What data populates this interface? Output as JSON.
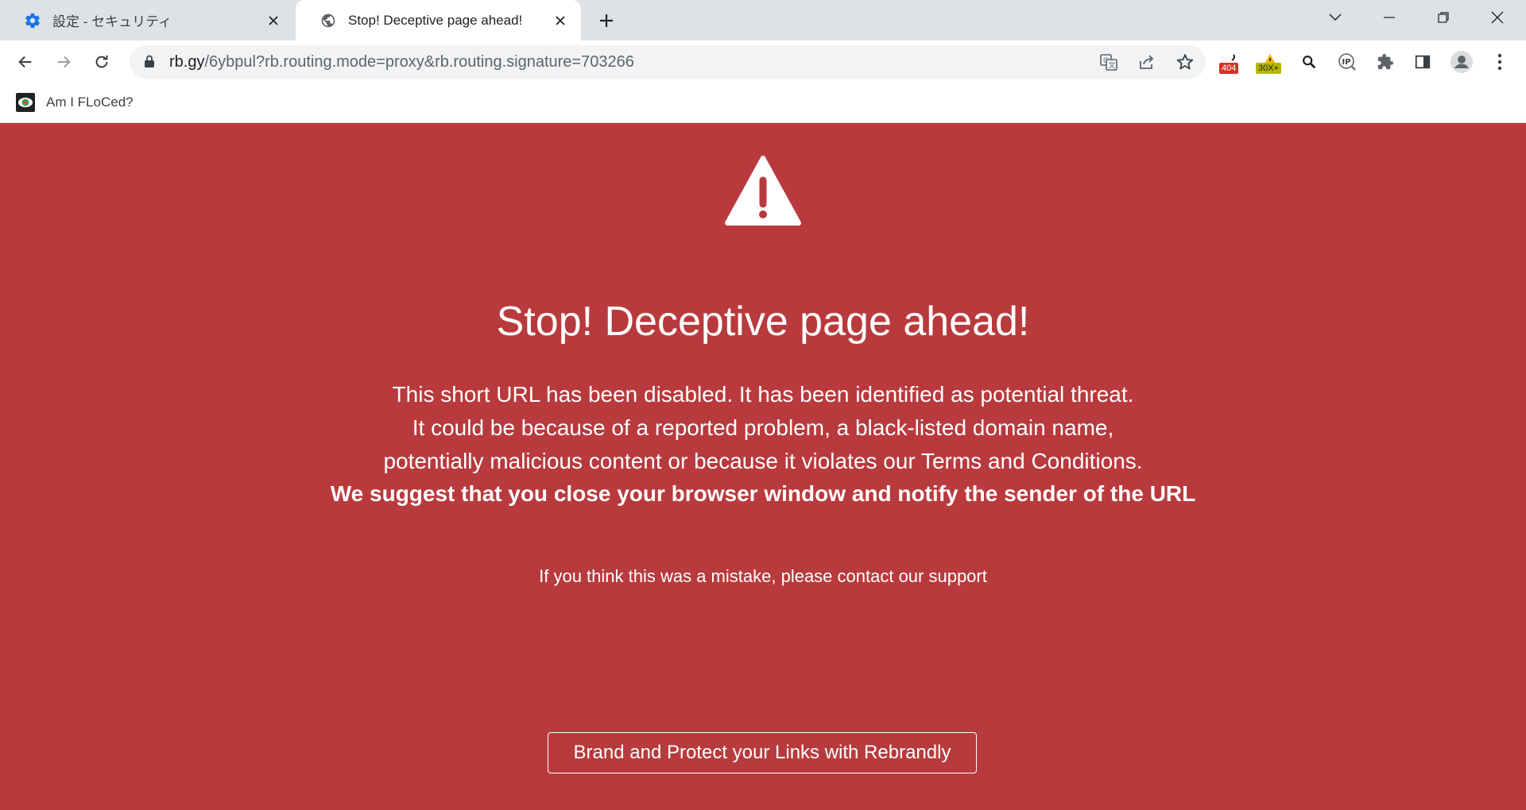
{
  "tabs": [
    {
      "title": "設定 - セキュリティ",
      "icon": "gear-icon",
      "active": false
    },
    {
      "title": "Stop! Deceptive page ahead!",
      "icon": "globe-icon",
      "active": true
    }
  ],
  "address_bar": {
    "host": "rb.gy",
    "path": "/6ybpul?rb.routing.mode=proxy&rb.routing.signature=703266"
  },
  "extensions": {
    "badge_404": "404",
    "badge_30x": "30X+",
    "ip_label": "IP"
  },
  "bookmarks": [
    {
      "label": "Am I FLoCed?",
      "icon": "eye-icon"
    }
  ],
  "page": {
    "heading": "Stop! Deceptive page ahead!",
    "lines": [
      "This short URL has been disabled. It has been identified as potential threat.",
      "It could be because of a reported problem, a black-listed domain name,",
      "potentially malicious content or because it violates our Terms and Conditions.",
      "We suggest that you close your browser window and notify the sender of the URL"
    ],
    "support_text": "If you think this was a mistake, please contact our support",
    "cta_label": "Brand and Protect your Links with Rebrandly"
  },
  "colors": {
    "page_background": "#b83a3d",
    "tabstrip": "#dee1e6",
    "badge_404": "#d93025",
    "badge_30x": "#b7b800"
  }
}
